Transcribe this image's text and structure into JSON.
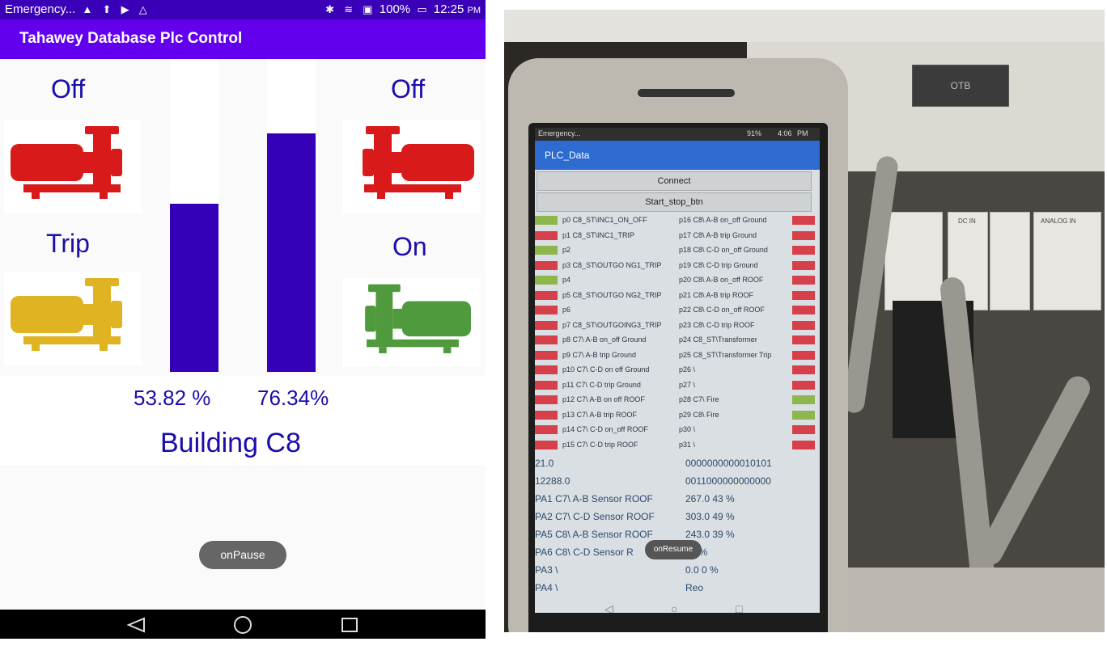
{
  "left_app": {
    "status_bar": {
      "left_text": "Emergency...",
      "battery": "100%",
      "time": "12:25",
      "ampm": "PM"
    },
    "app_title": "Tahawey Database Plc Control",
    "pumps": [
      {
        "label": "Off",
        "color": "#d81a1a"
      },
      {
        "label": "Trip",
        "color": "#e0b323"
      },
      {
        "label": "Off",
        "color": "#d81a1a"
      },
      {
        "label": "On",
        "color": "#4f9a3c"
      }
    ],
    "tanks": [
      {
        "percent_text": "53.82 %",
        "fill_fraction": 0.5382
      },
      {
        "percent_text": "76.34%",
        "fill_fraction": 0.7634
      }
    ],
    "building": "Building C8",
    "toast": "onPause"
  },
  "right_photo": {
    "screen_status": "Emergency...",
    "screen_status_right": "91%",
    "screen_time": "4:06",
    "screen_ampm": "PM",
    "app_title": "PLC_Data",
    "connect_label": "Connect",
    "start_stop_label": "Start_stop_btn",
    "left_rows": [
      {
        "text": "p0 C8_ST\\INC1_ON_OFF",
        "state": "green"
      },
      {
        "text": "p1 C8_ST\\INC1_TRIP",
        "state": "red"
      },
      {
        "text": "p2",
        "state": "green"
      },
      {
        "text": "p3 C8_ST\\OUTGO NG1_TRIP",
        "state": "red"
      },
      {
        "text": "p4",
        "state": "green"
      },
      {
        "text": "p5 C8_ST\\OUTGO NG2_TRIP",
        "state": "red"
      },
      {
        "text": "p6",
        "state": "red"
      },
      {
        "text": "p7 C8_ST\\OUTGOING3_TRIP",
        "state": "red"
      },
      {
        "text": "p8 C7\\ A-B on_off Ground",
        "state": "red"
      },
      {
        "text": "p9 C7\\ A-B trip Ground",
        "state": "red"
      },
      {
        "text": "p10 C7\\ C-D on off Ground",
        "state": "red"
      },
      {
        "text": "p11 C7\\ C-D trip Ground",
        "state": "red"
      },
      {
        "text": "p12 C7\\ A-B on off ROOF",
        "state": "red"
      },
      {
        "text": "p13 C7\\ A-B trip ROOF",
        "state": "red"
      },
      {
        "text": "p14 C7\\ C-D on_off ROOF",
        "state": "red"
      },
      {
        "text": "p15 C7\\ C-D trip ROOF",
        "state": "red"
      }
    ],
    "right_rows": [
      {
        "text": "p16 C8\\ A-B on_off Ground",
        "state": "red"
      },
      {
        "text": "p17 C8\\ A-B trip Ground",
        "state": "red"
      },
      {
        "text": "p18 C8\\ C-D on_off Ground",
        "state": "red"
      },
      {
        "text": "p19 C8\\ C-D trip Ground",
        "state": "red"
      },
      {
        "text": "p20 C8\\ A-B on_off ROOF",
        "state": "red"
      },
      {
        "text": "p21 C8\\ A-B trip ROOF",
        "state": "red"
      },
      {
        "text": "p22 C8\\ C-D on_off ROOF",
        "state": "red"
      },
      {
        "text": "p23 C8\\ C-D trip ROOF",
        "state": "red"
      },
      {
        "text": "p24 C8_ST\\Transformer",
        "state": "red"
      },
      {
        "text": "p25 C8_ST\\Transformer Trip",
        "state": "red"
      },
      {
        "text": "p26 \\",
        "state": "red"
      },
      {
        "text": "p27 \\",
        "state": "red"
      },
      {
        "text": "p28 C7\\ Fire",
        "state": "green"
      },
      {
        "text": "p29 C8\\ Fire",
        "state": "green"
      },
      {
        "text": "p30 \\",
        "state": "red"
      },
      {
        "text": "p31 \\",
        "state": "red"
      }
    ],
    "value_lines": [
      {
        "left": "21.0",
        "right": "0000000000010101"
      },
      {
        "left": "12288.0",
        "right": "0011000000000000"
      },
      {
        "left": "PA1 C7\\ A-B Sensor ROOF",
        "right": "267.0 43 %"
      },
      {
        "left": "PA2 C7\\ C-D Sensor ROOF",
        "right": "303.0 49 %"
      },
      {
        "left": "PA5 C8\\ A-B Sensor ROOF",
        "right": "243.0 39 %"
      },
      {
        "left": "PA6 C8\\ C-D Sensor R",
        "right": "41 %"
      },
      {
        "left": "PA3 \\",
        "right": "0.0 0 %"
      },
      {
        "left": "PA4 \\",
        "right": "Reo"
      }
    ],
    "screen_toast": "onResume",
    "panel_label": "OTB",
    "module_labels": [
      "DC IN",
      "ANALOG IN"
    ]
  }
}
